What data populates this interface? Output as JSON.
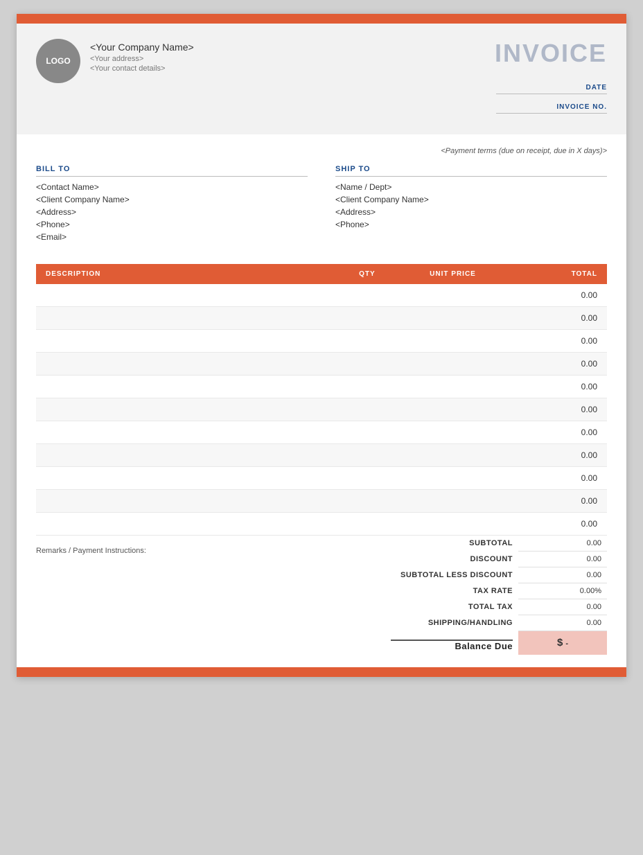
{
  "topBar": {
    "color": "#e05c35"
  },
  "header": {
    "logo_text": "LOGO",
    "company_name": "<Your Company Name>",
    "company_address": "<Your address>",
    "company_contact": "<Your contact details>",
    "invoice_title": "INVOICE",
    "date_label": "DATE",
    "invoice_no_label": "INVOICE NO."
  },
  "payment_terms": "<Payment terms (due on receipt, due in X days)>",
  "bill_to": {
    "label": "BILL TO",
    "contact_name": "<Contact Name>",
    "company_name": "<Client Company Name>",
    "address": "<Address>",
    "phone": "<Phone>",
    "email": "<Email>"
  },
  "ship_to": {
    "label": "SHIP TO",
    "name_dept": "<Name / Dept>",
    "company_name": "<Client Company Name>",
    "address": "<Address>",
    "phone": "<Phone>"
  },
  "table": {
    "headers": {
      "description": "DESCRIPTION",
      "qty": "QTY",
      "unit_price": "UNIT PRICE",
      "total": "TOTAL"
    },
    "rows": [
      {
        "description": "",
        "qty": "",
        "unit_price": "",
        "total": "0.00"
      },
      {
        "description": "",
        "qty": "",
        "unit_price": "",
        "total": "0.00"
      },
      {
        "description": "",
        "qty": "",
        "unit_price": "",
        "total": "0.00"
      },
      {
        "description": "",
        "qty": "",
        "unit_price": "",
        "total": "0.00"
      },
      {
        "description": "",
        "qty": "",
        "unit_price": "",
        "total": "0.00"
      },
      {
        "description": "",
        "qty": "",
        "unit_price": "",
        "total": "0.00"
      },
      {
        "description": "",
        "qty": "",
        "unit_price": "",
        "total": "0.00"
      },
      {
        "description": "",
        "qty": "",
        "unit_price": "",
        "total": "0.00"
      },
      {
        "description": "",
        "qty": "",
        "unit_price": "",
        "total": "0.00"
      },
      {
        "description": "",
        "qty": "",
        "unit_price": "",
        "total": "0.00"
      },
      {
        "description": "",
        "qty": "",
        "unit_price": "",
        "total": "0.00"
      }
    ]
  },
  "summary": {
    "remarks_label": "Remarks / Payment Instructions:",
    "subtotal_label": "SUBTOTAL",
    "subtotal_value": "0.00",
    "discount_label": "DISCOUNT",
    "discount_value": "0.00",
    "subtotal_less_discount_label": "SUBTOTAL LESS DISCOUNT",
    "subtotal_less_discount_value": "0.00",
    "tax_rate_label": "TAX RATE",
    "tax_rate_value": "0.00%",
    "total_tax_label": "TOTAL TAX",
    "total_tax_value": "0.00",
    "shipping_label": "SHIPPING/HANDLING",
    "shipping_value": "0.00",
    "balance_due_label": "Balance Due",
    "balance_due_currency": "$",
    "balance_due_value": "-"
  }
}
